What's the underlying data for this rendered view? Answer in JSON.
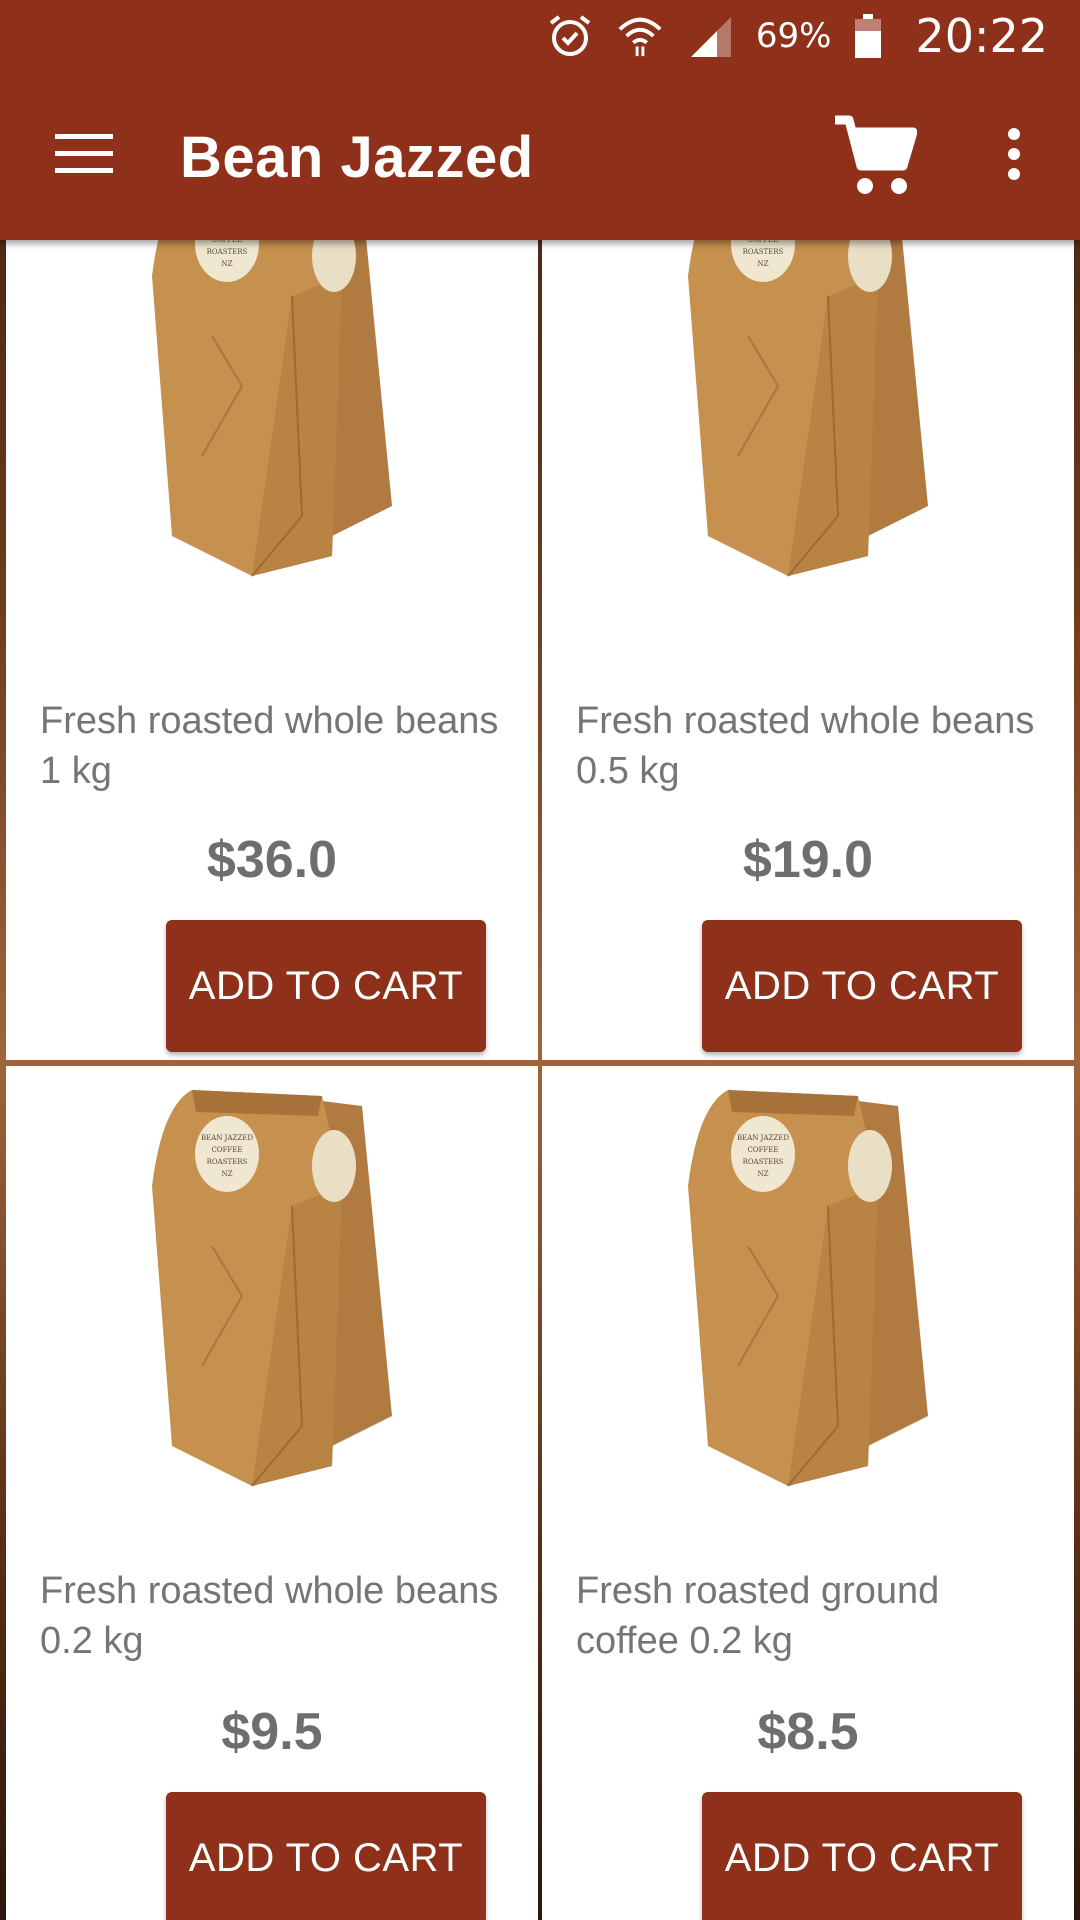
{
  "status_bar": {
    "battery": "69%",
    "time": "20:22",
    "icons": [
      "alarm-icon",
      "wifi-icon",
      "signal-icon",
      "battery-icon"
    ]
  },
  "app_bar": {
    "title": "Bean Jazzed",
    "icons": [
      "menu-icon",
      "cart-icon",
      "more-vert-icon"
    ]
  },
  "products": [
    {
      "name": "Fresh roasted whole beans   1 kg",
      "price": "$36.0",
      "button": "ADD TO CART"
    },
    {
      "name": "Fresh roasted whole beans 0.5 kg",
      "price": "$19.0",
      "button": "ADD TO CART"
    },
    {
      "name": "Fresh roasted whole beans 0.2 kg",
      "price": "$9.5",
      "button": "ADD TO CART"
    },
    {
      "name": "Fresh roasted ground coffee 0.2 kg",
      "price": "$8.5",
      "button": "ADD TO CART"
    }
  ],
  "bag_label": [
    "BEAN JAZZED",
    "COFFEE",
    "ROASTERS",
    "NZ"
  ],
  "colors": {
    "primary": "#8e301a",
    "text_secondary": "#757575",
    "kraft": "#c08a4e"
  }
}
